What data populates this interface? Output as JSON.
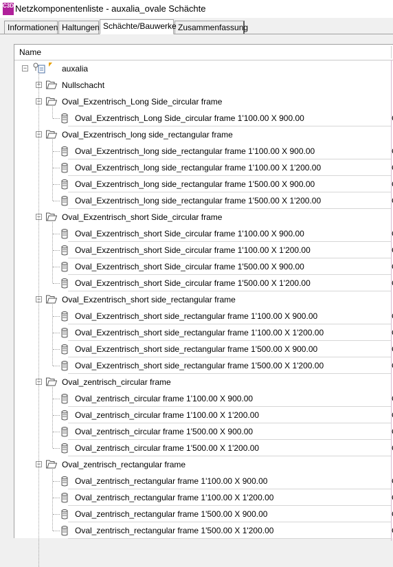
{
  "window": {
    "title": "Netzkomponentenliste - auxalia_ovale Schächte",
    "icon_text": "C3D"
  },
  "tabs": [
    {
      "label": "Informationen"
    },
    {
      "label": "Haltungen"
    },
    {
      "label": "Schächte/Bauwerke"
    },
    {
      "label": "Zusammenfassung"
    }
  ],
  "tree": {
    "column_header": "Name",
    "root": "auxalia",
    "collapsed_label": "Nullschacht",
    "cut_text": "C",
    "groups": [
      {
        "label": "Oval_Exzentrisch_Long Side_circular frame",
        "items": [
          "Oval_Exzentrisch_Long Side_circular frame 1'100.00 X 900.00"
        ]
      },
      {
        "label": "Oval_Exzentrisch_long side_rectangular frame",
        "items": [
          "Oval_Exzentrisch_long side_rectangular frame 1'100.00 X 900.00",
          "Oval_Exzentrisch_long side_rectangular frame 1'100.00 X 1'200.00",
          "Oval_Exzentrisch_long side_rectangular frame 1'500.00 X 900.00",
          "Oval_Exzentrisch_long side_rectangular frame 1'500.00 X 1'200.00"
        ]
      },
      {
        "label": "Oval_Exzentrisch_short Side_circular frame",
        "items": [
          "Oval_Exzentrisch_short Side_circular frame 1'100.00 X 900.00",
          "Oval_Exzentrisch_short Side_circular frame 1'100.00 X 1'200.00",
          "Oval_Exzentrisch_short Side_circular frame 1'500.00 X 900.00",
          "Oval_Exzentrisch_short Side_circular frame 1'500.00 X 1'200.00"
        ]
      },
      {
        "label": "Oval_Exzentrisch_short side_rectangular frame",
        "items": [
          "Oval_Exzentrisch_short side_rectangular frame 1'100.00 X 900.00",
          "Oval_Exzentrisch_short side_rectangular frame 1'100.00 X 1'200.00",
          "Oval_Exzentrisch_short side_rectangular frame 1'500.00 X 900.00",
          "Oval_Exzentrisch_short side_rectangular frame 1'500.00 X 1'200.00"
        ]
      },
      {
        "label": "Oval_zentrisch_circular frame",
        "items": [
          "Oval_zentrisch_circular frame 1'100.00 X 900.00",
          "Oval_zentrisch_circular frame 1'100.00 X 1'200.00",
          "Oval_zentrisch_circular frame 1'500.00 X 900.00",
          "Oval_zentrisch_circular frame 1'500.00 X 1'200.00"
        ]
      },
      {
        "label": "Oval_zentrisch_rectangular frame",
        "items": [
          "Oval_zentrisch_rectangular frame 1'100.00 X 900.00",
          "Oval_zentrisch_rectangular frame 1'100.00 X 1'200.00",
          "Oval_zentrisch_rectangular frame 1'500.00 X 900.00",
          "Oval_zentrisch_rectangular frame 1'500.00 X 1'200.00"
        ]
      }
    ]
  }
}
